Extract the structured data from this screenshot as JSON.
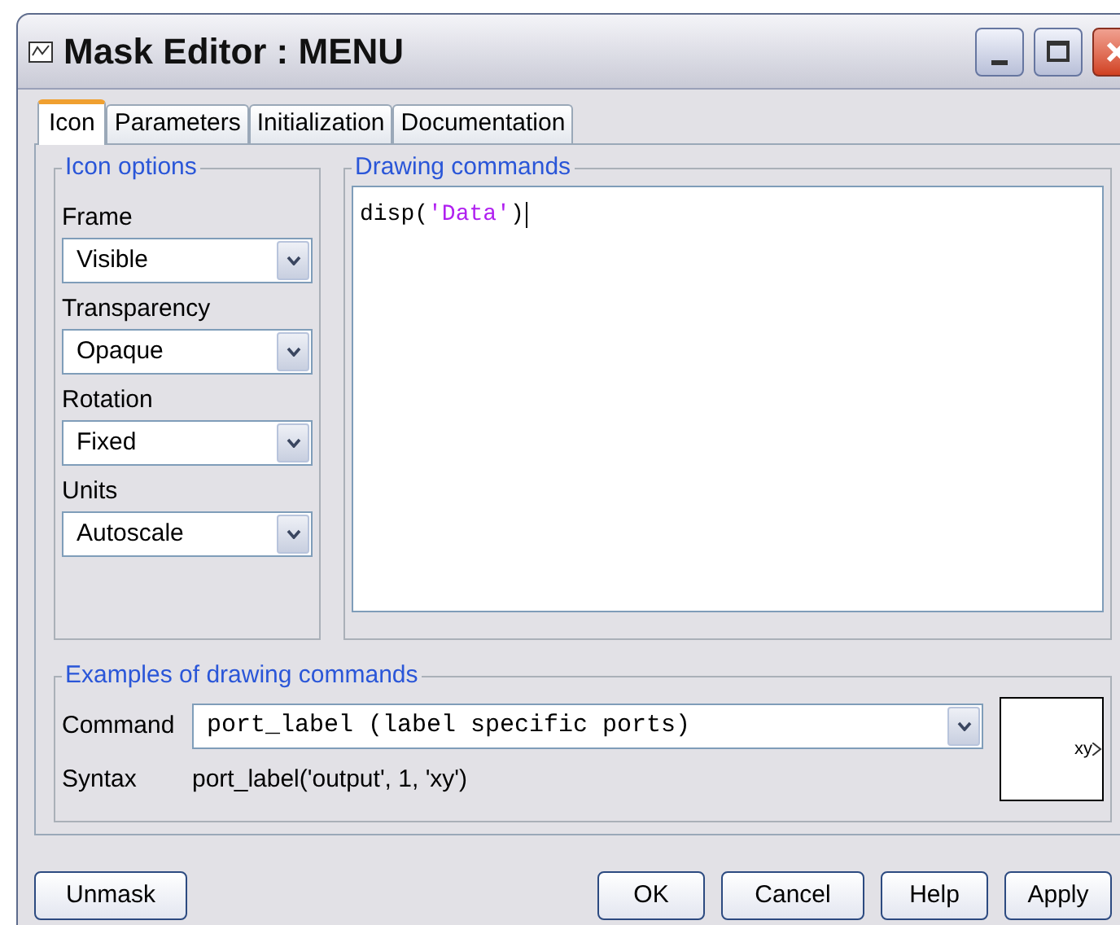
{
  "window": {
    "title": "Mask Editor : MENU"
  },
  "tabs": [
    {
      "label": "Icon",
      "selected": true
    },
    {
      "label": "Parameters",
      "selected": false
    },
    {
      "label": "Initialization",
      "selected": false
    },
    {
      "label": "Documentation",
      "selected": false
    }
  ],
  "icon_options": {
    "title": "Icon options",
    "fields": [
      {
        "label": "Frame",
        "value": "Visible"
      },
      {
        "label": "Transparency",
        "value": "Opaque"
      },
      {
        "label": "Rotation",
        "value": "Fixed"
      },
      {
        "label": "Units",
        "value": "Autoscale"
      }
    ]
  },
  "drawing_commands": {
    "title": "Drawing commands",
    "code": [
      {
        "text": "disp(",
        "kind": "plain"
      },
      {
        "text": "'Data'",
        "kind": "string"
      },
      {
        "text": ")",
        "kind": "plain"
      }
    ]
  },
  "examples": {
    "title": "Examples of drawing commands",
    "command_label": "Command",
    "command_value": "port_label (label specific ports)",
    "syntax_label": "Syntax",
    "syntax_value": "port_label('output', 1, 'xy')",
    "preview_label": "xy"
  },
  "buttons_left": [
    "Unmask"
  ],
  "buttons_right": [
    "OK",
    "Cancel",
    "Help",
    "Apply"
  ]
}
